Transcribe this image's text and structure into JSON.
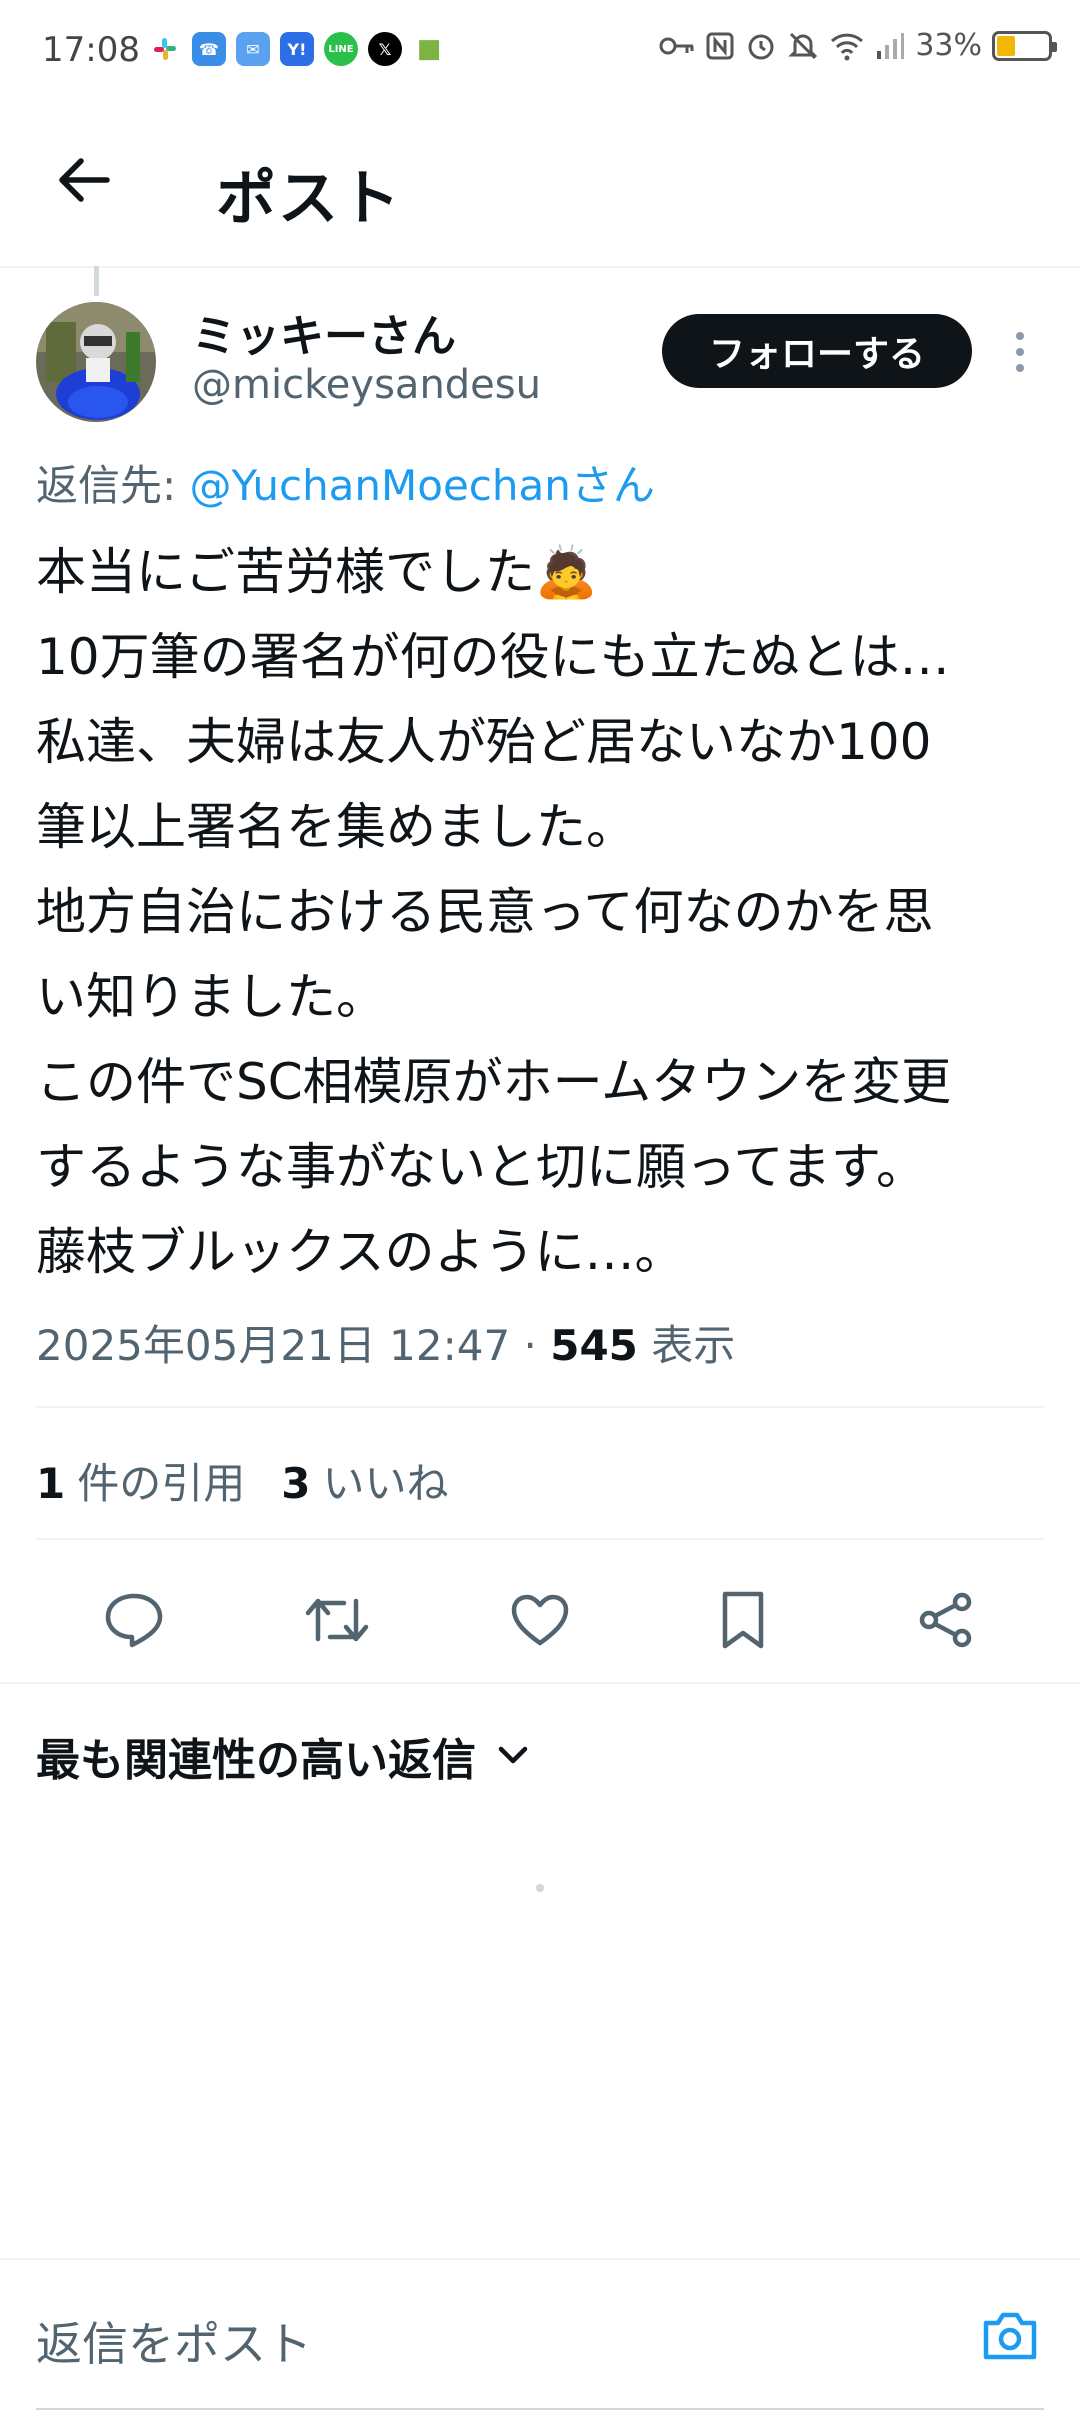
{
  "status_bar": {
    "time": "17:08",
    "battery": "33%",
    "battery_level": 0.33
  },
  "header": {
    "title": "ポスト",
    "back_icon": "arrow-left-icon"
  },
  "tweet": {
    "author_name": "ミッキーさん",
    "author_handle": "@mickeysandesu",
    "follow_label": "フォローする",
    "reply_to_prefix": "返信先: ",
    "reply_to_mention": "@YuchanMoechanさん",
    "body": "本当にご苦労様でした🙇\n10万筆の署名が何の役にも立たぬとは…\n私達、夫婦は友人が殆ど居ないなか100\n筆以上署名を集めました。\n地方自治における民意って何なのかを思\nい知りました。\nこの件でSC相模原がホームタウンを変更\nするような事がないと切に願ってます。\n藤枝ブルックスのように…。",
    "timestamp": "2025年05月21日 12:47",
    "separator": " · ",
    "views_count": "545",
    "views_label": " 表示"
  },
  "stats": {
    "quotes_count": "1",
    "quotes_label": "件の引用",
    "likes_count": "3",
    "likes_label": "いいね"
  },
  "actions": [
    "reply-icon",
    "retweet-icon",
    "like-icon",
    "bookmark-icon",
    "share-icon"
  ],
  "replies": {
    "sort_label": "最も関連性の高い返信"
  },
  "reply_bar": {
    "placeholder": "返信をポスト"
  },
  "colors": {
    "accent": "#1d9bf0",
    "text_primary": "#0f1419",
    "text_secondary": "#536471",
    "divider": "#eff3f4"
  }
}
